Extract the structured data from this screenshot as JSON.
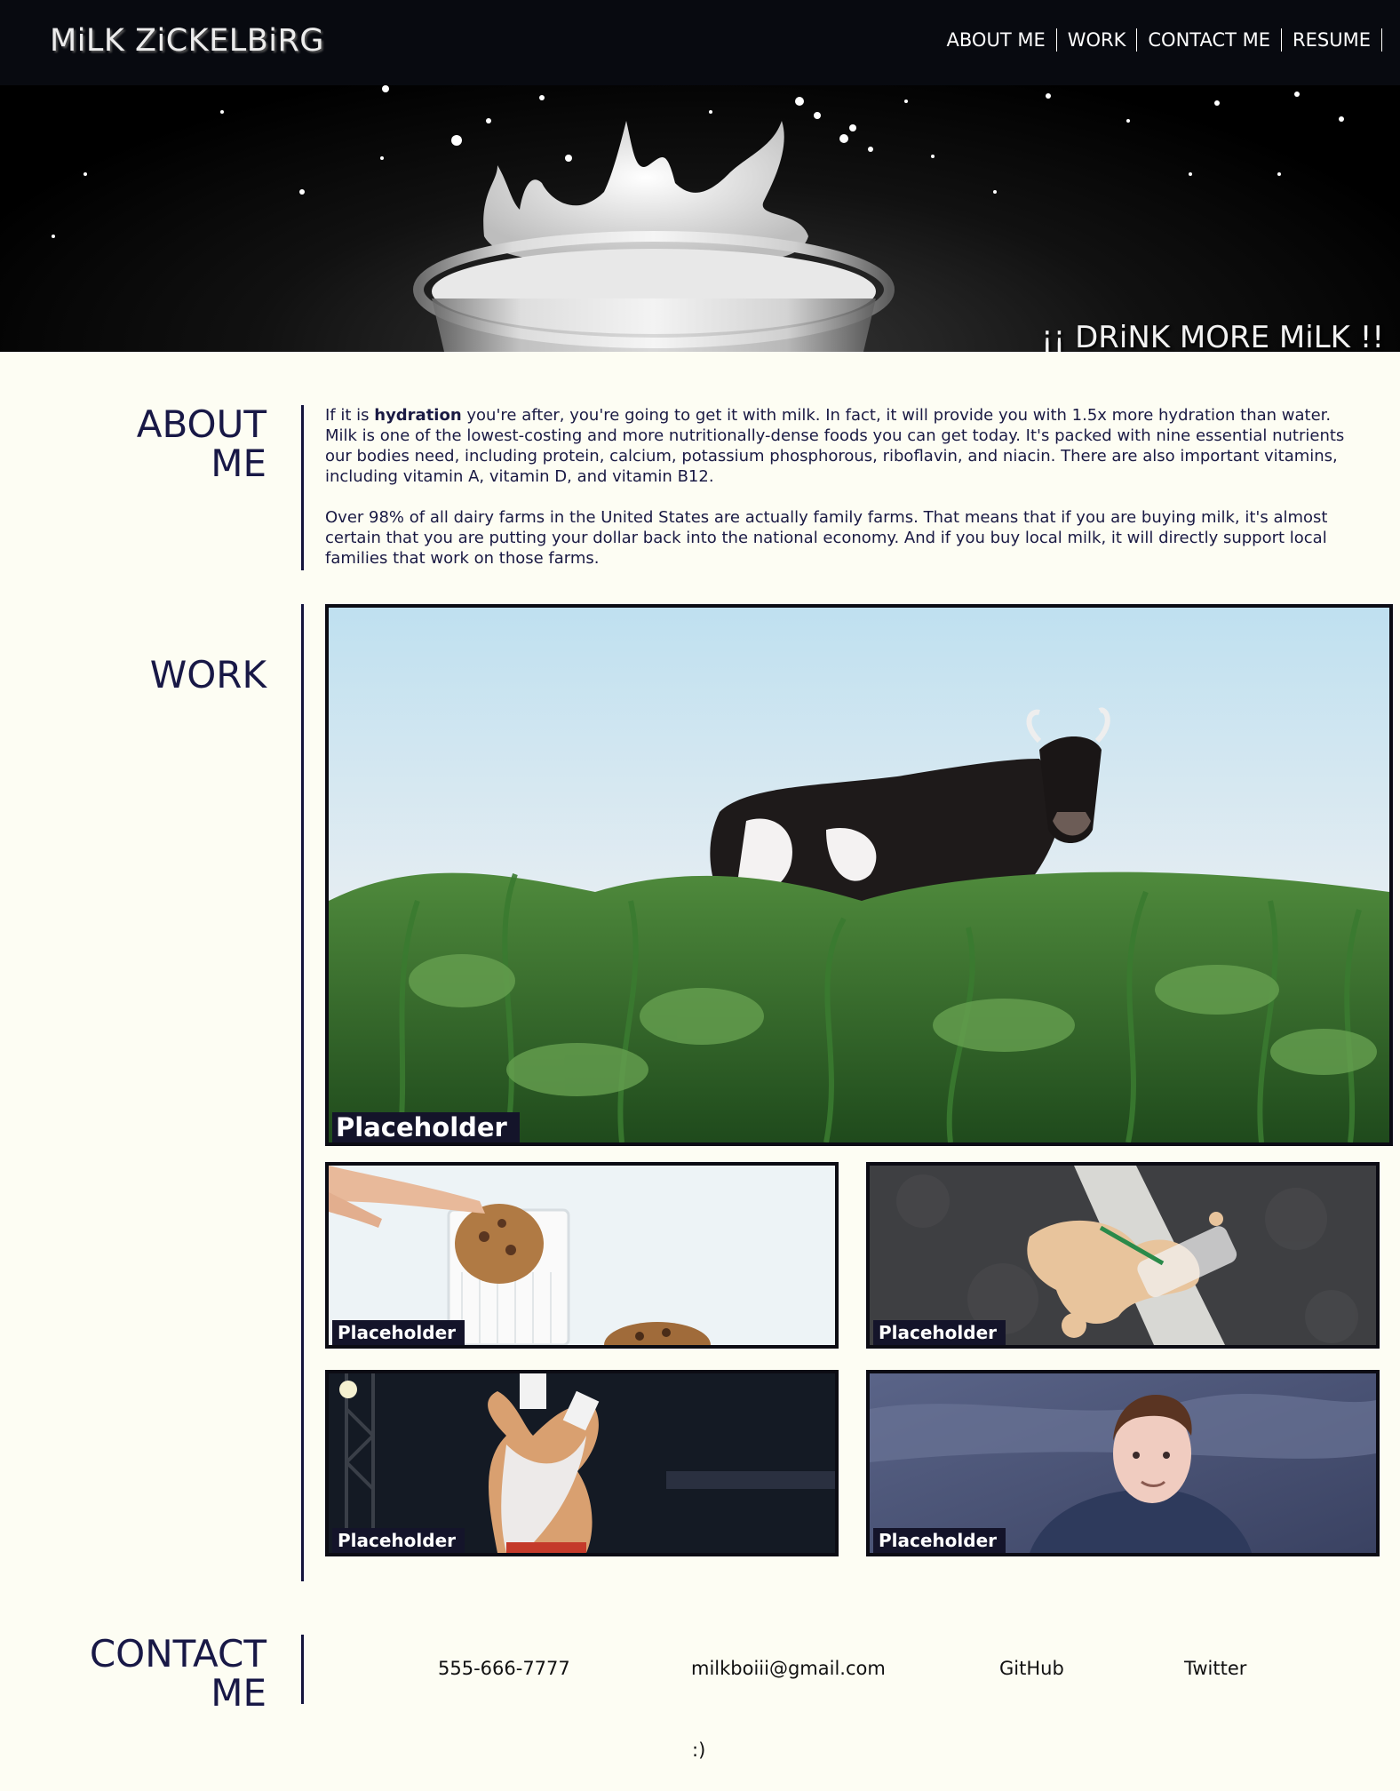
{
  "header": {
    "brand": "MiLK ZiCKELBiRG",
    "nav": [
      "ABOUT ME",
      "WORK",
      "CONTACT ME",
      "RESUME"
    ]
  },
  "hero": {
    "tagline": "¡¡ DRiNK MORE MiLK !!"
  },
  "about": {
    "title_line1": "ABOUT",
    "title_line2": "ME",
    "p1_before": "If it is ",
    "p1_bold": "hydration",
    "p1_after": " you're after, you're going to get it with milk. In fact, it will provide you with 1.5x more hydration than water. Milk is one of the lowest-costing and more nutritionally-dense foods you can get today. It's packed with nine essential nutrients our bodies need, including protein, calcium, potassium phosphorous, riboflavin, and niacin. There are also important vitamins, including vitamin A, vitamin D, and vitamin B12.",
    "p2": "Over 98% of all dairy farms in the United States are actually family farms. That means that if you are buying milk, it's almost certain that you are putting your dollar back into the national economy. And if you buy local milk, it will directly support local families that work on those farms."
  },
  "work": {
    "title": "WORK",
    "items": [
      {
        "caption": "Placeholder",
        "image": "cow-in-field"
      },
      {
        "caption": "Placeholder",
        "image": "cookie-dunk-milk"
      },
      {
        "caption": "Placeholder",
        "image": "spilled-coffee"
      },
      {
        "caption": "Placeholder",
        "image": "milk-pour-wrestler"
      },
      {
        "caption": "Placeholder",
        "image": "man-portrait"
      }
    ]
  },
  "contact": {
    "title_line1": "CONTACT",
    "title_line2": "ME",
    "phone": "555-666-7777",
    "email": "milkboiii@gmail.com",
    "github": "GitHub",
    "twitter": "Twitter"
  },
  "footer": {
    "smile": ":)"
  },
  "colors": {
    "nav_bg": "#080a10",
    "page_bg": "#fdfdf3",
    "heading": "#181846",
    "caption_bg": "#14142a"
  }
}
